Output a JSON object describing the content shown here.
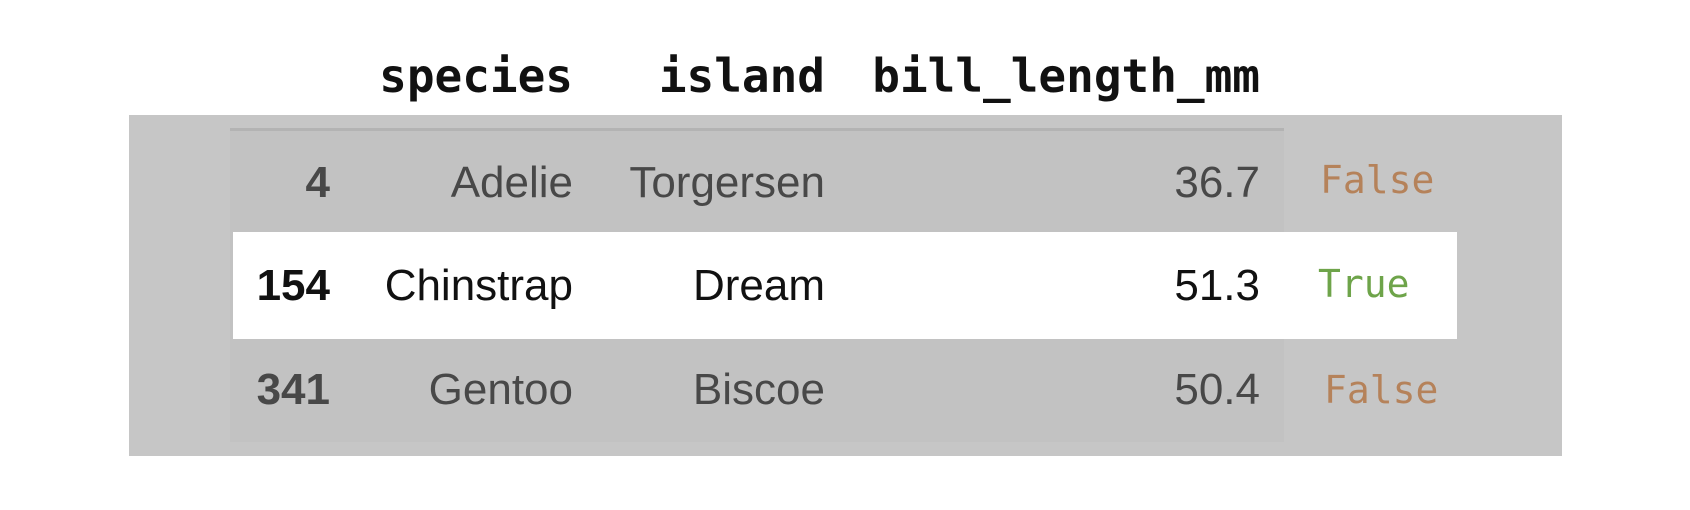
{
  "columns": [
    "species",
    "island",
    "bill_length_mm"
  ],
  "rows": [
    {
      "index": "4",
      "species": "Adelie",
      "island": "Torgersen",
      "bill_length_mm": "36.7",
      "flag": "False"
    },
    {
      "index": "154",
      "species": "Chinstrap",
      "island": "Dream",
      "bill_length_mm": "51.3",
      "flag": "True"
    },
    {
      "index": "341",
      "species": "Gentoo",
      "island": "Biscoe",
      "bill_length_mm": "50.4",
      "flag": "False"
    }
  ],
  "highlighted_row": 1,
  "colors": {
    "false_flag": "#b5825a",
    "true_flag": "#6ea44a",
    "panel_bg": "#c6c6c6",
    "highlight_bg": "#ffffff"
  }
}
